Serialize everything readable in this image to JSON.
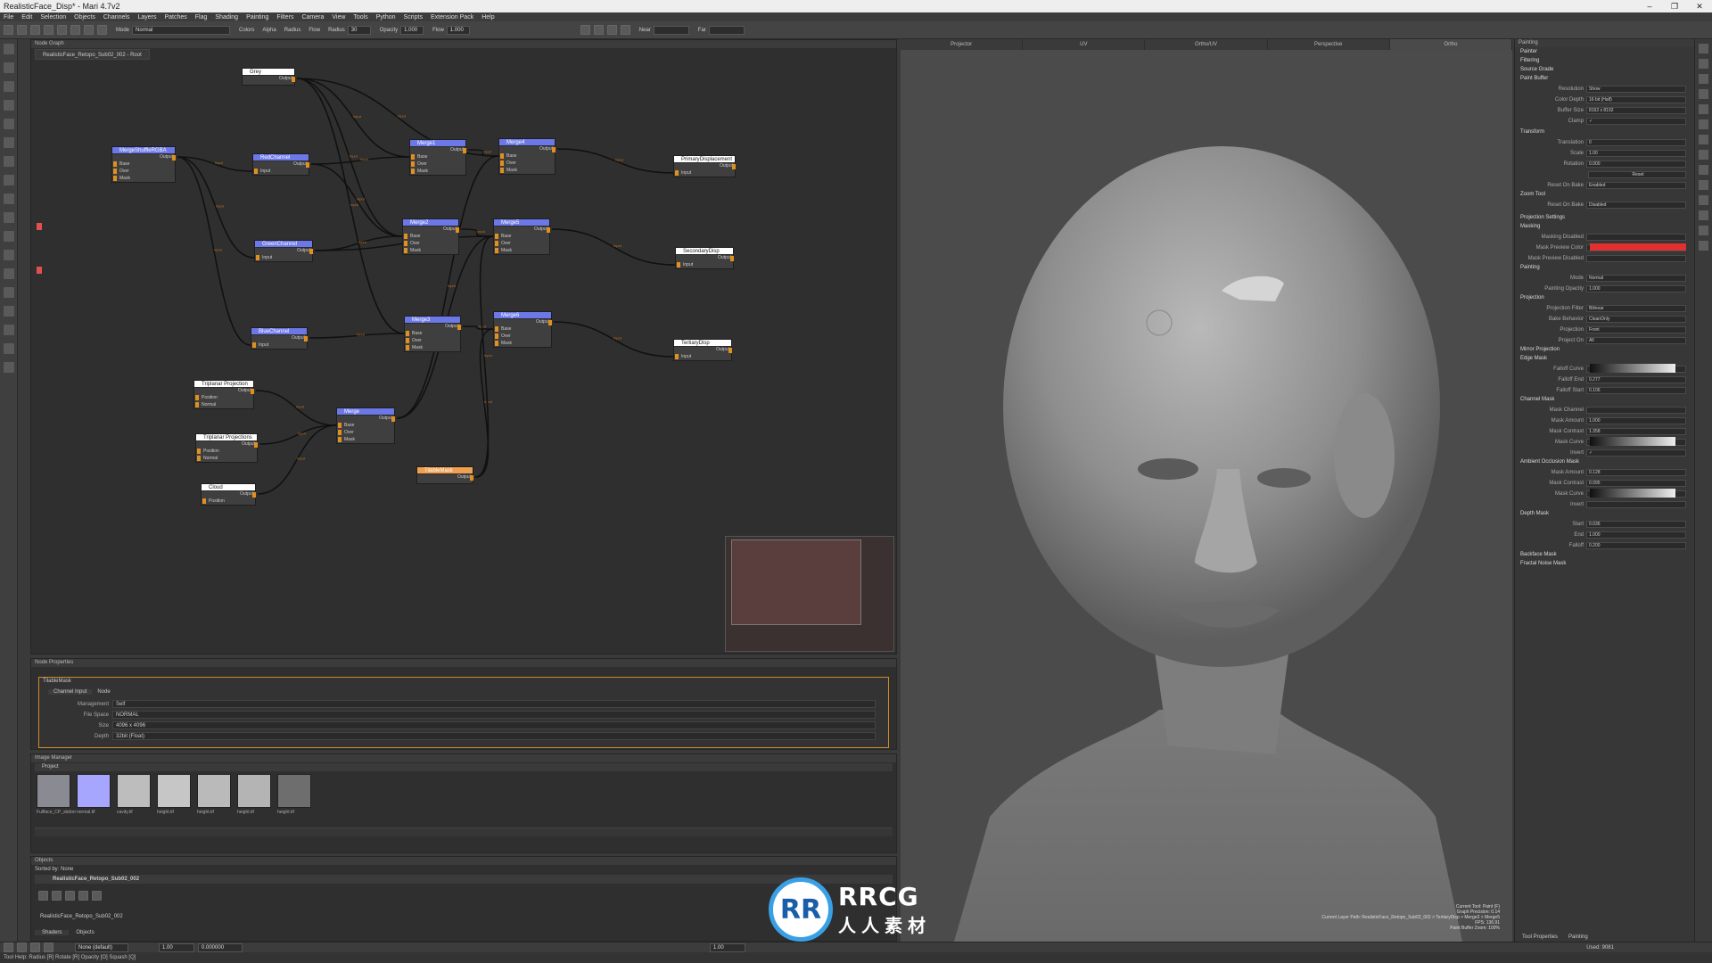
{
  "app": {
    "title": "RealisticFace_Disp* - Mari 4.7v2",
    "win_min": "–",
    "win_max": "❐",
    "win_close": "✕"
  },
  "menu": [
    "File",
    "Edit",
    "Selection",
    "Objects",
    "Channels",
    "Layers",
    "Patches",
    "Flag",
    "Shading",
    "Painting",
    "Filters",
    "Camera",
    "View",
    "Tools",
    "Python",
    "Scripts",
    "Extension Pack",
    "Help"
  ],
  "toolbar": {
    "mode_label": "Mode",
    "mode_value": "Normal",
    "colors_label": "Colors",
    "alpha_label": "Alpha",
    "radius_label": "Radius",
    "flow_label": "Flow",
    "radius_value": "30",
    "opacity_label": "Opacity",
    "opacity_value": "1.000",
    "flow_value": "1.000",
    "near_label": "Near",
    "far_label": "Far"
  },
  "node_graph": {
    "panel_title": "Node Graph",
    "tab": "RealisticFace_Retopo_Sub02_002 - Root",
    "nodes": [
      {
        "id": "grey",
        "label": "Grey",
        "out": "Output",
        "ports": [],
        "color": "#ffffff"
      },
      {
        "id": "merge_shuffle",
        "label": "MergeShuffleRGBA",
        "out": "Output",
        "ports": [
          "Base",
          "Over",
          "Mask"
        ],
        "color": "#6c78e8"
      },
      {
        "id": "red",
        "label": "RedChannel",
        "out": "Output",
        "ports": [
          "Input"
        ],
        "color": "#6c78e8"
      },
      {
        "id": "green",
        "label": "GreenChannel",
        "out": "Output",
        "ports": [
          "Input"
        ],
        "color": "#6c78e8"
      },
      {
        "id": "blue",
        "label": "BlueChannel",
        "out": "Output",
        "ports": [
          "Input"
        ],
        "color": "#6c78e8"
      },
      {
        "id": "merge1",
        "label": "Merge1",
        "out": "Output",
        "ports": [
          "Base",
          "Over",
          "Mask"
        ],
        "color": "#6c78e8"
      },
      {
        "id": "merge2",
        "label": "Merge2",
        "out": "Output",
        "ports": [
          "Base",
          "Over",
          "Mask"
        ],
        "color": "#6c78e8"
      },
      {
        "id": "merge3",
        "label": "Merge3",
        "out": "Output",
        "ports": [
          "Base",
          "Over",
          "Mask"
        ],
        "color": "#6c78e8"
      },
      {
        "id": "merge4",
        "label": "Merge4",
        "out": "Output",
        "ports": [
          "Base",
          "Over",
          "Mask"
        ],
        "color": "#6c78e8"
      },
      {
        "id": "merge5",
        "label": "Merge5",
        "out": "Output",
        "ports": [
          "Base",
          "Over",
          "Mask"
        ],
        "color": "#6c78e8"
      },
      {
        "id": "merge6",
        "label": "Merge6",
        "out": "Output",
        "ports": [
          "Base",
          "Over",
          "Mask"
        ],
        "color": "#6c78e8"
      },
      {
        "id": "primary",
        "label": "PrimaryDisplacement",
        "out": "Output",
        "ports": [
          "Input"
        ],
        "color": "#ffffff"
      },
      {
        "id": "secondary",
        "label": "SecondaryDisp",
        "out": "Output",
        "ports": [
          "Input"
        ],
        "color": "#ffffff"
      },
      {
        "id": "tertiary",
        "label": "TertiaryDisp",
        "out": "Output",
        "ports": [
          "Input"
        ],
        "color": "#ffffff"
      },
      {
        "id": "triplanar1",
        "label": "Triplanar Projection",
        "out": "Output",
        "ports": [
          "Position",
          "Normal"
        ],
        "color": "#ffffff"
      },
      {
        "id": "triplanar2",
        "label": "Triplanar Projections",
        "out": "Output",
        "ports": [
          "Position",
          "Normal"
        ],
        "color": "#ffffff"
      },
      {
        "id": "merge",
        "label": "Merge",
        "out": "Output",
        "ports": [
          "Base",
          "Over",
          "Mask"
        ],
        "color": "#6c78e8"
      },
      {
        "id": "cloud",
        "label": "Cloud",
        "out": "Output",
        "ports": [
          "Position"
        ],
        "color": "#ffffff"
      },
      {
        "id": "tilablemask",
        "label": "TilableMask",
        "out": "Output",
        "ports": [],
        "color": "#f0a050"
      }
    ],
    "edge_label": "Input"
  },
  "node_props": {
    "panel_title": "Node Properties",
    "node": "TilableMask",
    "tabs": [
      "Channel Input",
      "Node"
    ],
    "rows": [
      {
        "k": "Management",
        "v": "Self"
      },
      {
        "k": "File Space",
        "v": "NORMAL"
      },
      {
        "k": "Size",
        "v": "4096 x 4096"
      },
      {
        "k": "Depth",
        "v": "32bit (Float)"
      }
    ]
  },
  "image_manager": {
    "panel_title": "Image Manager",
    "section": "Project",
    "images": [
      {
        "name": "Fullface_CP_sbdormal.tif",
        "color": "#8a8a92"
      },
      {
        "name": "normal.tif",
        "color": "#a6a6ff"
      },
      {
        "name": "cavity.tif",
        "color": "#bdbdbd"
      },
      {
        "name": "height.tif",
        "color": "#c6c6c6"
      },
      {
        "name": "height.tif",
        "color": "#bababa"
      },
      {
        "name": "height.tif",
        "color": "#b4b4b4"
      },
      {
        "name": "height.tif",
        "color": "#6e6e6e"
      }
    ]
  },
  "objects": {
    "panel_title": "Objects",
    "sorted_by": "Sorted by:",
    "sorted_value": "None",
    "root": "RealisticFace_Retopo_Sub02_002",
    "child": "RealisticFace_Retopo_Sub02_002",
    "tabs": [
      "Shaders",
      "Objects"
    ]
  },
  "viewport": {
    "tabs": [
      "Projector",
      "UV",
      "Ortho/UV",
      "Perspective",
      "Ortho"
    ],
    "info": [
      "Current Tool: Paint (F)",
      "Graph Precision: 0.14",
      "Current Layer Path: RealisticFace_Retopo_Sub02_002 > TertiaryDisp > Merge3 > Merge5",
      "FPS: 136.91",
      "Paint Buffer Zoom: 100%"
    ]
  },
  "right_panel": {
    "title": "Painting",
    "sections": [
      "Painter",
      "Filtering",
      "Source Grade",
      "Paint Buffer"
    ],
    "paint_buffer": [
      {
        "k": "Resolution",
        "v": "Show"
      },
      {
        "k": "Color Depth",
        "v": "16 bit (Half)"
      },
      {
        "k": "Buffer Size",
        "v": "8192 x 8192"
      },
      {
        "k": "Clamp",
        "v": "✓"
      }
    ],
    "transform_title": "Transform",
    "transform": [
      {
        "k": "Translation",
        "v": "0"
      },
      {
        "k": "Scale",
        "v": "1.00"
      },
      {
        "k": "Rotation",
        "v": "0.000"
      }
    ],
    "reset_label": "Reset",
    "reset_on_bake": [
      {
        "k": "Reset On Bake",
        "v": "Enabled"
      }
    ],
    "zoom_title": "Zoom Tool",
    "zoom": [
      {
        "k": "Reset On Bake",
        "v": "Disabled"
      }
    ],
    "proj_settings": "Projection Settings",
    "masking": "Masking",
    "mask_rows": [
      {
        "k": "Masking Disabled",
        "v": ""
      },
      {
        "k": "Mask Preview Color",
        "v": ""
      },
      {
        "k": "Mask Preview Disabled",
        "v": ""
      }
    ],
    "mask_preview_color": "#e23030",
    "painting": "Painting",
    "painting_rows": [
      {
        "k": "Mode",
        "v": "Normal"
      },
      {
        "k": "Painting Opacity",
        "v": "1.000"
      }
    ],
    "projection": "Projection",
    "projection_rows": [
      {
        "k": "Projection Filter",
        "v": "Bilinear"
      },
      {
        "k": "Bake Behavior",
        "v": "CleanOnly"
      },
      {
        "k": "Projection",
        "v": "Front"
      },
      {
        "k": "Project On",
        "v": "All"
      }
    ],
    "mirror": "Mirror Projection",
    "edge_mask": "Edge Mask",
    "edge_rows": [
      {
        "k": "Falloff Curve",
        "v": ""
      },
      {
        "k": "Falloff End",
        "v": "0.277"
      },
      {
        "k": "Falloff Start",
        "v": "0.106"
      }
    ],
    "channel_mask": "Channel Mask",
    "channel_rows": [
      {
        "k": "Mask Channel",
        "v": ""
      },
      {
        "k": "Mask Amount",
        "v": "1.000"
      },
      {
        "k": "Mask Contrast",
        "v": "1.358"
      },
      {
        "k": "Mask Curve",
        "v": ""
      },
      {
        "k": "Invert",
        "v": "✓"
      }
    ],
    "ao_mask": "Ambient Occlusion Mask",
    "ao_rows": [
      {
        "k": "Mask Amount",
        "v": "0.128"
      },
      {
        "k": "Mask Contrast",
        "v": "0.095"
      },
      {
        "k": "Mask Curve",
        "v": ""
      },
      {
        "k": "Invert",
        "v": ""
      }
    ],
    "depth_mask": "Depth Mask",
    "depth_rows": [
      {
        "k": "Start",
        "v": "0.036"
      },
      {
        "k": "End",
        "v": "1.000"
      },
      {
        "k": "Falloff",
        "v": "0.200"
      }
    ],
    "backface": "Backface Mask",
    "fractal": "Fractal Noise Mask",
    "bottom_tabs": [
      "Tool Properties",
      "Painting"
    ]
  },
  "status": {
    "left": "None (default)",
    "mid": "1.00",
    "right": "0.000000",
    "zoom": "1.00",
    "mem": "Used: 9081"
  },
  "help": "Tool Help: Radius [R] Rotate [R] Opacity [O] Squash [Q]",
  "watermark": {
    "logo": "RR",
    "line1": "RRCG",
    "line2": "人人素材"
  }
}
